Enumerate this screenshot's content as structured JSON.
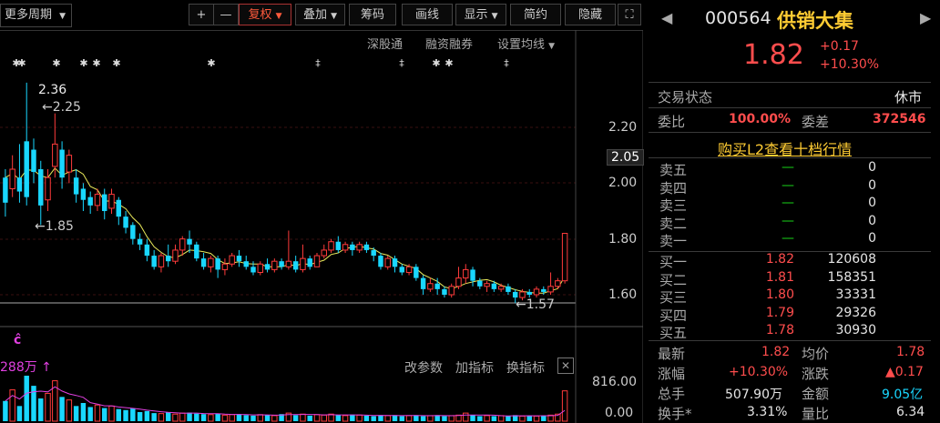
{
  "toolbar": {
    "period_label": "更多周期",
    "buttons": [
      "+",
      "—",
      "复权",
      "叠加",
      "筹码",
      "画线",
      "显示",
      "简约",
      "隐藏"
    ],
    "sub_links": [
      "深股通",
      "融资融券",
      "设置均线"
    ]
  },
  "chart": {
    "price_labels": [
      "2.20",
      "2.00",
      "1.80",
      "1.60"
    ],
    "current_price_tag": "2.05",
    "annotations": {
      "high": "2.36",
      "high2": "←2.25",
      "low": "←1.85",
      "low2": "←1.57"
    },
    "volume_label": "288万",
    "volume_tools": [
      "改参数",
      "加指标",
      "换指标"
    ],
    "volume_axis": [
      "816.00",
      "0.00"
    ],
    "candles": [
      {
        "o": 1.93,
        "c": 2.02,
        "h": 2.05,
        "l": 1.88,
        "up": false
      },
      {
        "o": 1.98,
        "c": 2.05,
        "h": 2.1,
        "l": 1.95,
        "up": true
      },
      {
        "o": 2.02,
        "c": 1.97,
        "h": 2.14,
        "l": 1.93,
        "up": false
      },
      {
        "o": 1.95,
        "c": 2.15,
        "h": 2.36,
        "l": 1.92,
        "up": false
      },
      {
        "o": 2.12,
        "c": 2.04,
        "h": 2.16,
        "l": 2.0,
        "up": false
      },
      {
        "o": 2.05,
        "c": 1.92,
        "h": 2.08,
        "l": 1.85,
        "up": false
      },
      {
        "o": 1.94,
        "c": 2.02,
        "h": 2.05,
        "l": 1.9,
        "up": true
      },
      {
        "o": 2.06,
        "c": 2.14,
        "h": 2.25,
        "l": 2.02,
        "up": true
      },
      {
        "o": 2.12,
        "c": 2.02,
        "h": 2.15,
        "l": 1.98,
        "up": false
      },
      {
        "o": 2.04,
        "c": 2.1,
        "h": 2.12,
        "l": 2.0,
        "up": true
      },
      {
        "o": 2.02,
        "c": 1.96,
        "h": 2.05,
        "l": 1.93,
        "up": false
      },
      {
        "o": 1.98,
        "c": 1.94,
        "h": 2.0,
        "l": 1.9,
        "up": false
      },
      {
        "o": 1.95,
        "c": 1.92,
        "h": 1.97,
        "l": 1.89,
        "up": false
      },
      {
        "o": 1.92,
        "c": 1.96,
        "h": 1.98,
        "l": 1.9,
        "up": true
      },
      {
        "o": 1.96,
        "c": 1.9,
        "h": 1.98,
        "l": 1.87,
        "up": false
      },
      {
        "o": 1.91,
        "c": 1.96,
        "h": 1.98,
        "l": 1.89,
        "up": true
      },
      {
        "o": 1.94,
        "c": 1.88,
        "h": 1.95,
        "l": 1.85,
        "up": false
      },
      {
        "o": 1.88,
        "c": 1.84,
        "h": 1.9,
        "l": 1.82,
        "up": false
      },
      {
        "o": 1.85,
        "c": 1.8,
        "h": 1.86,
        "l": 1.78,
        "up": false
      },
      {
        "o": 1.8,
        "c": 1.78,
        "h": 1.82,
        "l": 1.76,
        "up": false
      },
      {
        "o": 1.78,
        "c": 1.74,
        "h": 1.8,
        "l": 1.72,
        "up": false
      },
      {
        "o": 1.74,
        "c": 1.7,
        "h": 1.76,
        "l": 1.69,
        "up": false
      },
      {
        "o": 1.7,
        "c": 1.74,
        "h": 1.75,
        "l": 1.68,
        "up": true
      },
      {
        "o": 1.74,
        "c": 1.72,
        "h": 1.78,
        "l": 1.7,
        "up": false
      },
      {
        "o": 1.72,
        "c": 1.76,
        "h": 1.78,
        "l": 1.71,
        "up": true
      },
      {
        "o": 1.76,
        "c": 1.8,
        "h": 1.81,
        "l": 1.74,
        "up": true
      },
      {
        "o": 1.8,
        "c": 1.78,
        "h": 1.83,
        "l": 1.75,
        "up": false
      },
      {
        "o": 1.78,
        "c": 1.73,
        "h": 1.79,
        "l": 1.72,
        "up": false
      },
      {
        "o": 1.73,
        "c": 1.7,
        "h": 1.75,
        "l": 1.69,
        "up": false
      },
      {
        "o": 1.7,
        "c": 1.73,
        "h": 1.74,
        "l": 1.68,
        "up": true
      },
      {
        "o": 1.73,
        "c": 1.69,
        "h": 1.74,
        "l": 1.66,
        "up": false
      },
      {
        "o": 1.69,
        "c": 1.71,
        "h": 1.73,
        "l": 1.67,
        "up": true
      },
      {
        "o": 1.71,
        "c": 1.74,
        "h": 1.75,
        "l": 1.7,
        "up": true
      },
      {
        "o": 1.74,
        "c": 1.72,
        "h": 1.76,
        "l": 1.7,
        "up": false
      },
      {
        "o": 1.72,
        "c": 1.7,
        "h": 1.74,
        "l": 1.69,
        "up": false
      },
      {
        "o": 1.7,
        "c": 1.68,
        "h": 1.72,
        "l": 1.67,
        "up": false
      },
      {
        "o": 1.68,
        "c": 1.71,
        "h": 1.72,
        "l": 1.67,
        "up": true
      },
      {
        "o": 1.71,
        "c": 1.69,
        "h": 1.73,
        "l": 1.68,
        "up": false
      },
      {
        "o": 1.69,
        "c": 1.72,
        "h": 1.73,
        "l": 1.68,
        "up": true
      },
      {
        "o": 1.72,
        "c": 1.7,
        "h": 1.73,
        "l": 1.69,
        "up": false
      },
      {
        "o": 1.7,
        "c": 1.72,
        "h": 1.83,
        "l": 1.69,
        "up": true
      },
      {
        "o": 1.72,
        "c": 1.69,
        "h": 1.74,
        "l": 1.68,
        "up": false
      },
      {
        "o": 1.69,
        "c": 1.73,
        "h": 1.78,
        "l": 1.68,
        "up": true
      },
      {
        "o": 1.73,
        "c": 1.7,
        "h": 1.74,
        "l": 1.69,
        "up": false
      },
      {
        "o": 1.7,
        "c": 1.74,
        "h": 1.75,
        "l": 1.7,
        "up": true
      },
      {
        "o": 1.74,
        "c": 1.76,
        "h": 1.78,
        "l": 1.73,
        "up": true
      },
      {
        "o": 1.76,
        "c": 1.79,
        "h": 1.8,
        "l": 1.75,
        "up": true
      },
      {
        "o": 1.79,
        "c": 1.76,
        "h": 1.81,
        "l": 1.75,
        "up": false
      },
      {
        "o": 1.76,
        "c": 1.78,
        "h": 1.79,
        "l": 1.75,
        "up": true
      },
      {
        "o": 1.78,
        "c": 1.76,
        "h": 1.79,
        "l": 1.74,
        "up": false
      },
      {
        "o": 1.76,
        "c": 1.78,
        "h": 1.79,
        "l": 1.75,
        "up": true
      },
      {
        "o": 1.78,
        "c": 1.76,
        "h": 1.79,
        "l": 1.75,
        "up": false
      },
      {
        "o": 1.76,
        "c": 1.74,
        "h": 1.77,
        "l": 1.72,
        "up": false
      },
      {
        "o": 1.74,
        "c": 1.7,
        "h": 1.75,
        "l": 1.69,
        "up": false
      },
      {
        "o": 1.7,
        "c": 1.73,
        "h": 1.74,
        "l": 1.69,
        "up": true
      },
      {
        "o": 1.73,
        "c": 1.7,
        "h": 1.74,
        "l": 1.68,
        "up": false
      },
      {
        "o": 1.7,
        "c": 1.68,
        "h": 1.71,
        "l": 1.67,
        "up": false
      },
      {
        "o": 1.68,
        "c": 1.7,
        "h": 1.71,
        "l": 1.67,
        "up": true
      },
      {
        "o": 1.7,
        "c": 1.66,
        "h": 1.71,
        "l": 1.65,
        "up": false
      },
      {
        "o": 1.66,
        "c": 1.62,
        "h": 1.67,
        "l": 1.6,
        "up": false
      },
      {
        "o": 1.62,
        "c": 1.64,
        "h": 1.66,
        "l": 1.61,
        "up": true
      },
      {
        "o": 1.64,
        "c": 1.62,
        "h": 1.66,
        "l": 1.6,
        "up": false
      },
      {
        "o": 1.62,
        "c": 1.6,
        "h": 1.63,
        "l": 1.59,
        "up": false
      },
      {
        "o": 1.6,
        "c": 1.63,
        "h": 1.64,
        "l": 1.59,
        "up": true
      },
      {
        "o": 1.63,
        "c": 1.66,
        "h": 1.7,
        "l": 1.62,
        "up": true
      },
      {
        "o": 1.66,
        "c": 1.69,
        "h": 1.71,
        "l": 1.64,
        "up": true
      },
      {
        "o": 1.69,
        "c": 1.65,
        "h": 1.7,
        "l": 1.63,
        "up": false
      },
      {
        "o": 1.65,
        "c": 1.63,
        "h": 1.66,
        "l": 1.62,
        "up": false
      },
      {
        "o": 1.63,
        "c": 1.64,
        "h": 1.65,
        "l": 1.61,
        "up": true
      },
      {
        "o": 1.64,
        "c": 1.62,
        "h": 1.65,
        "l": 1.61,
        "up": false
      },
      {
        "o": 1.62,
        "c": 1.63,
        "h": 1.64,
        "l": 1.61,
        "up": true
      },
      {
        "o": 1.63,
        "c": 1.61,
        "h": 1.64,
        "l": 1.6,
        "up": false
      },
      {
        "o": 1.61,
        "c": 1.59,
        "h": 1.62,
        "l": 1.57,
        "up": false
      },
      {
        "o": 1.59,
        "c": 1.61,
        "h": 1.62,
        "l": 1.58,
        "up": true
      },
      {
        "o": 1.61,
        "c": 1.6,
        "h": 1.62,
        "l": 1.59,
        "up": false
      },
      {
        "o": 1.6,
        "c": 1.62,
        "h": 1.63,
        "l": 1.59,
        "up": true
      },
      {
        "o": 1.62,
        "c": 1.61,
        "h": 1.63,
        "l": 1.6,
        "up": false
      },
      {
        "o": 1.61,
        "c": 1.63,
        "h": 1.68,
        "l": 1.6,
        "up": true
      },
      {
        "o": 1.63,
        "c": 1.65,
        "h": 1.66,
        "l": 1.62,
        "up": true
      },
      {
        "o": 1.65,
        "c": 1.82,
        "h": 1.82,
        "l": 1.64,
        "up": true
      }
    ],
    "volumes": [
      40,
      62,
      30,
      90,
      70,
      45,
      55,
      80,
      48,
      42,
      30,
      36,
      28,
      32,
      26,
      30,
      24,
      22,
      25,
      18,
      20,
      16,
      15,
      18,
      14,
      16,
      17,
      15,
      14,
      13,
      15,
      12,
      13,
      14,
      12,
      11,
      13,
      12,
      11,
      14,
      16,
      12,
      14,
      11,
      13,
      12,
      14,
      12,
      11,
      13,
      12,
      11,
      10,
      12,
      11,
      12,
      10,
      11,
      12,
      10,
      11,
      12,
      10,
      11,
      12,
      16,
      12,
      10,
      11,
      10,
      11,
      10,
      12,
      10,
      11,
      10,
      11,
      12,
      14,
      60
    ]
  },
  "quote": {
    "code": "000564",
    "name": "供销大集",
    "price": "1.82",
    "change": "+0.17",
    "change_pct": "+10.30%",
    "status_label": "交易状态",
    "status_value": "休市",
    "wb_label": "委比",
    "wb_value": "100.00%",
    "wc_label": "委差",
    "wc_value": "372546",
    "l2_link": "购买L2查看十档行情",
    "asks": [
      {
        "label": "卖五",
        "price": "—",
        "vol": "0"
      },
      {
        "label": "卖四",
        "price": "—",
        "vol": "0"
      },
      {
        "label": "卖三",
        "price": "—",
        "vol": "0"
      },
      {
        "label": "卖二",
        "price": "—",
        "vol": "0"
      },
      {
        "label": "卖一",
        "price": "—",
        "vol": "0"
      }
    ],
    "bids": [
      {
        "label": "买一",
        "price": "1.82",
        "vol": "120608"
      },
      {
        "label": "买二",
        "price": "1.81",
        "vol": "158351"
      },
      {
        "label": "买三",
        "price": "1.80",
        "vol": "33331"
      },
      {
        "label": "买四",
        "price": "1.79",
        "vol": "29326"
      },
      {
        "label": "买五",
        "price": "1.78",
        "vol": "30930"
      }
    ],
    "stats": {
      "last_label": "最新",
      "last": "1.82",
      "avg_label": "均价",
      "avg": "1.78",
      "zf_label": "涨幅",
      "zf": "+10.30%",
      "zd_label": "涨跌",
      "zd": "▲0.17",
      "zs_label": "总手",
      "zs": "507.90万",
      "je_label": "金额",
      "je": "9.05亿",
      "hs_label": "换手*",
      "hs": "3.31%",
      "lb_label": "量比",
      "lb": "6.34"
    }
  },
  "colors": {
    "up": "#ff3b3b",
    "down": "#19d7ff",
    "ma": "#e8e85a",
    "accent": "#ff4d4d"
  }
}
